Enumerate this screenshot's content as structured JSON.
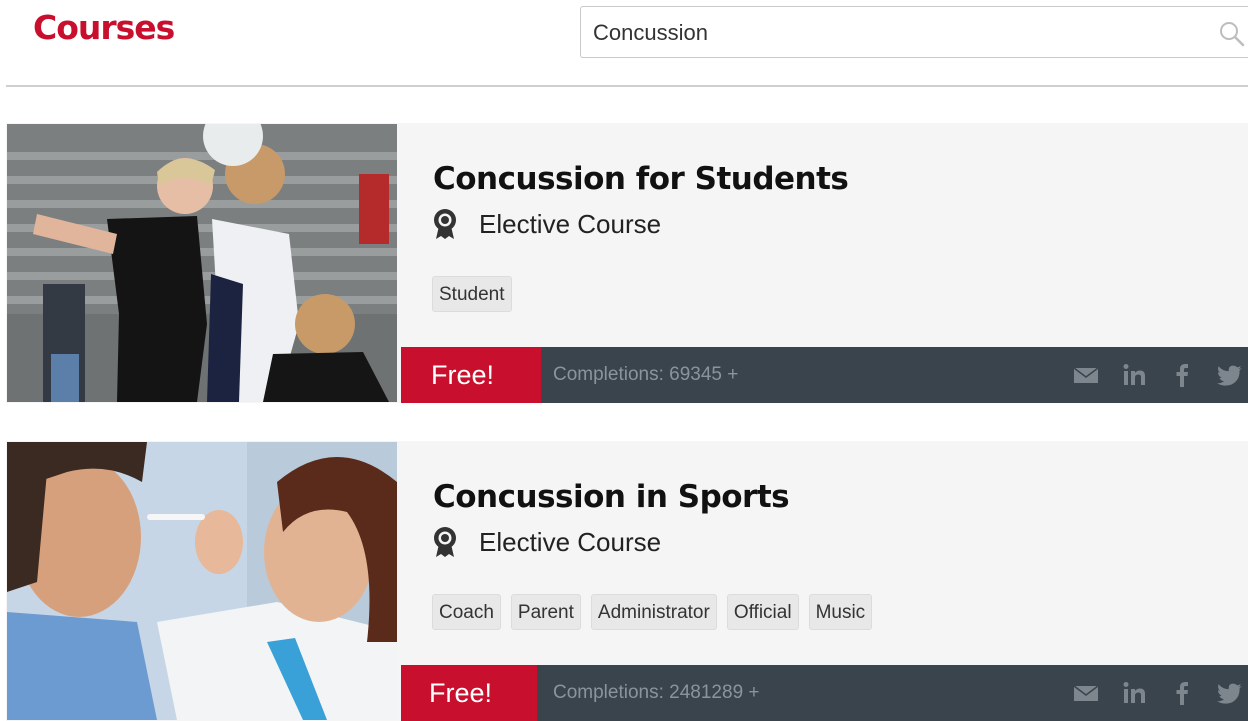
{
  "header": {
    "title": "Courses",
    "search": {
      "value": "Concussion",
      "placeholder": ""
    }
  },
  "courses": [
    {
      "title": "Concussion for Students",
      "type_label": "Elective Course",
      "tags": [
        "Student"
      ],
      "price_label": "Free!",
      "completions": "Completions: 69345 +",
      "image_icon": "girls-soccer-photo"
    },
    {
      "title": "Concussion in Sports",
      "type_label": "Elective Course",
      "tags": [
        "Coach",
        "Parent",
        "Administrator",
        "Official",
        "Music"
      ],
      "price_label": "Free!",
      "completions": "Completions: 2481289 +",
      "image_icon": "doctor-patient-photo"
    }
  ],
  "share_icons": [
    "email-icon",
    "linkedin-icon",
    "facebook-icon",
    "twitter-icon"
  ],
  "colors": {
    "brand_red": "#c8102e",
    "footer_bar": "#3a444c",
    "card_background": "#f5f5f5",
    "completions_text": "#8a949b",
    "share_icon": "#7d868d"
  }
}
